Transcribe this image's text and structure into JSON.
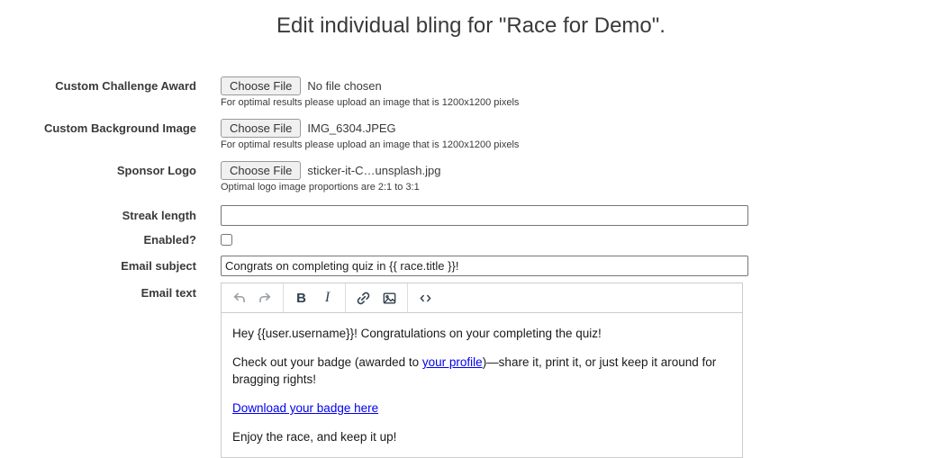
{
  "page": {
    "title": "Edit individual bling for \"Race for Demo\"."
  },
  "form": {
    "file_fields": [
      {
        "label": "Custom Challenge Award",
        "button_label": "Choose File",
        "file_name": "No file chosen",
        "help": "For optimal results please upload an image that is 1200x1200 pixels"
      },
      {
        "label": "Custom Background Image",
        "button_label": "Choose File",
        "file_name": "IMG_6304.JPEG",
        "help": "For optimal results please upload an image that is 1200x1200 pixels"
      },
      {
        "label": "Sponsor Logo",
        "button_label": "Choose File",
        "file_name": "sticker-it-C…unsplash.jpg",
        "help": "Optimal logo image proportions are 2:1 to 3:1"
      }
    ],
    "streak_length": {
      "label": "Streak length",
      "value": ""
    },
    "enabled": {
      "label": "Enabled?",
      "checked": false
    },
    "email_subject": {
      "label": "Email subject",
      "value": "Congrats on completing quiz in {{ race.title }}!"
    },
    "email_text": {
      "label": "Email text"
    }
  },
  "editor": {
    "toolbar": {
      "undo_icon": "undo-arrow",
      "redo_icon": "redo-arrow",
      "bold_label": "B",
      "italic_label": "I",
      "link_icon": "chain-link",
      "image_icon": "picture",
      "code_icon": "code-brackets"
    },
    "content": {
      "p1": "Hey {{user.username}}! Congratulations on your completing the quiz!",
      "p2_before": "Check out your badge (awarded to ",
      "p2_link": "your profile",
      "p2_after": ")—share it, print it, or just keep it around for bragging rights!",
      "p3_link": "Download your badge here",
      "p4": "Enjoy the race, and keep it up!"
    }
  },
  "colors": {
    "title_text": "#3a3a3a",
    "label_text": "#3a3a3a",
    "link_blue": "#0000ee",
    "toolbar_icon": "#32414e",
    "toolbar_icon_disabled": "#9aa0a6",
    "editor_border": "#cccccc",
    "input_border": "#767676",
    "file_button_bg": "#f0f0f0"
  }
}
